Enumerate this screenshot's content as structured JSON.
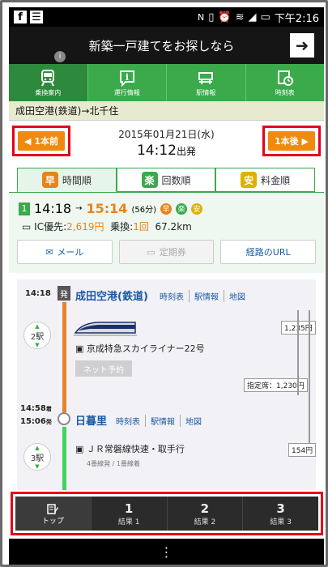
{
  "status_bar": {
    "time": "下午2:16",
    "left_icons": [
      "f",
      "☰"
    ],
    "right_icons": [
      "N",
      "vibrate",
      "alarm",
      "wifi",
      "signal",
      "battery"
    ]
  },
  "ad": {
    "text": "新築一戸建てをお探しなら",
    "arrow": "➜",
    "info": "i"
  },
  "nav": {
    "tabs": [
      {
        "label": "乗換案内"
      },
      {
        "label": "運行情報"
      },
      {
        "label": "駅情報"
      },
      {
        "label": "時刻表"
      }
    ]
  },
  "route": {
    "title": "成田空港(鉄道)→北千住"
  },
  "date_row": {
    "prev_label": "1本前",
    "next_label": "1本後",
    "date": "2015年01月21日(水)",
    "time": "14:12",
    "suffix": "出発"
  },
  "sort_tabs": [
    {
      "badge": "早",
      "label": "時間順",
      "color": "#e8831a"
    },
    {
      "badge": "楽",
      "label": "回数順",
      "color": "#3aaa4b"
    },
    {
      "badge": "安",
      "label": "料金順",
      "color": "#e0b000"
    }
  ],
  "result": {
    "number": "1",
    "depart": "14:18",
    "arrow": "→",
    "arrive": "15:14",
    "duration": "(56分)",
    "badges": [
      {
        "text": "早",
        "color": "#e8831a"
      },
      {
        "text": "楽",
        "color": "#3aaa4b"
      },
      {
        "text": "安",
        "color": "#e0b000"
      }
    ],
    "ic_label": "IC優先:",
    "fare": "2,619円",
    "transfer_label": "乗換:",
    "transfer_count": "1回",
    "distance": "67.2km",
    "buttons": {
      "mail": "メール",
      "pass": "定期券",
      "url": "経路のURL"
    }
  },
  "detail": {
    "stop1": {
      "time": "14:18",
      "mark": "発",
      "station": "成田空港(鉄道)",
      "links": [
        "時刻表",
        "駅情報",
        "地図"
      ]
    },
    "leg1": {
      "stops": "2駅",
      "train": "京成特急スカイライナー22号",
      "reserve": "ネット予約",
      "fare": "1,235円",
      "reserved_fare": "指定席：1,230円"
    },
    "stop2": {
      "arrive": "14:58",
      "arrive_mark": "着",
      "depart": "15:06",
      "depart_mark": "発",
      "station": "日暮里",
      "links": [
        "時刻表",
        "駅情報",
        "地図"
      ]
    },
    "leg2": {
      "stops": "3駅",
      "train": "ＪＲ常磐線快速・取手行",
      "tracks": "4番線発 / 1番線着",
      "fare": "154円"
    }
  },
  "bottom_tabs": [
    {
      "num": "",
      "label": "トップ"
    },
    {
      "num": "1",
      "label": "結果 1"
    },
    {
      "num": "2",
      "label": "結果 2"
    },
    {
      "num": "3",
      "label": "結果 3"
    }
  ],
  "android_nav": {
    "menu": "⋮"
  }
}
